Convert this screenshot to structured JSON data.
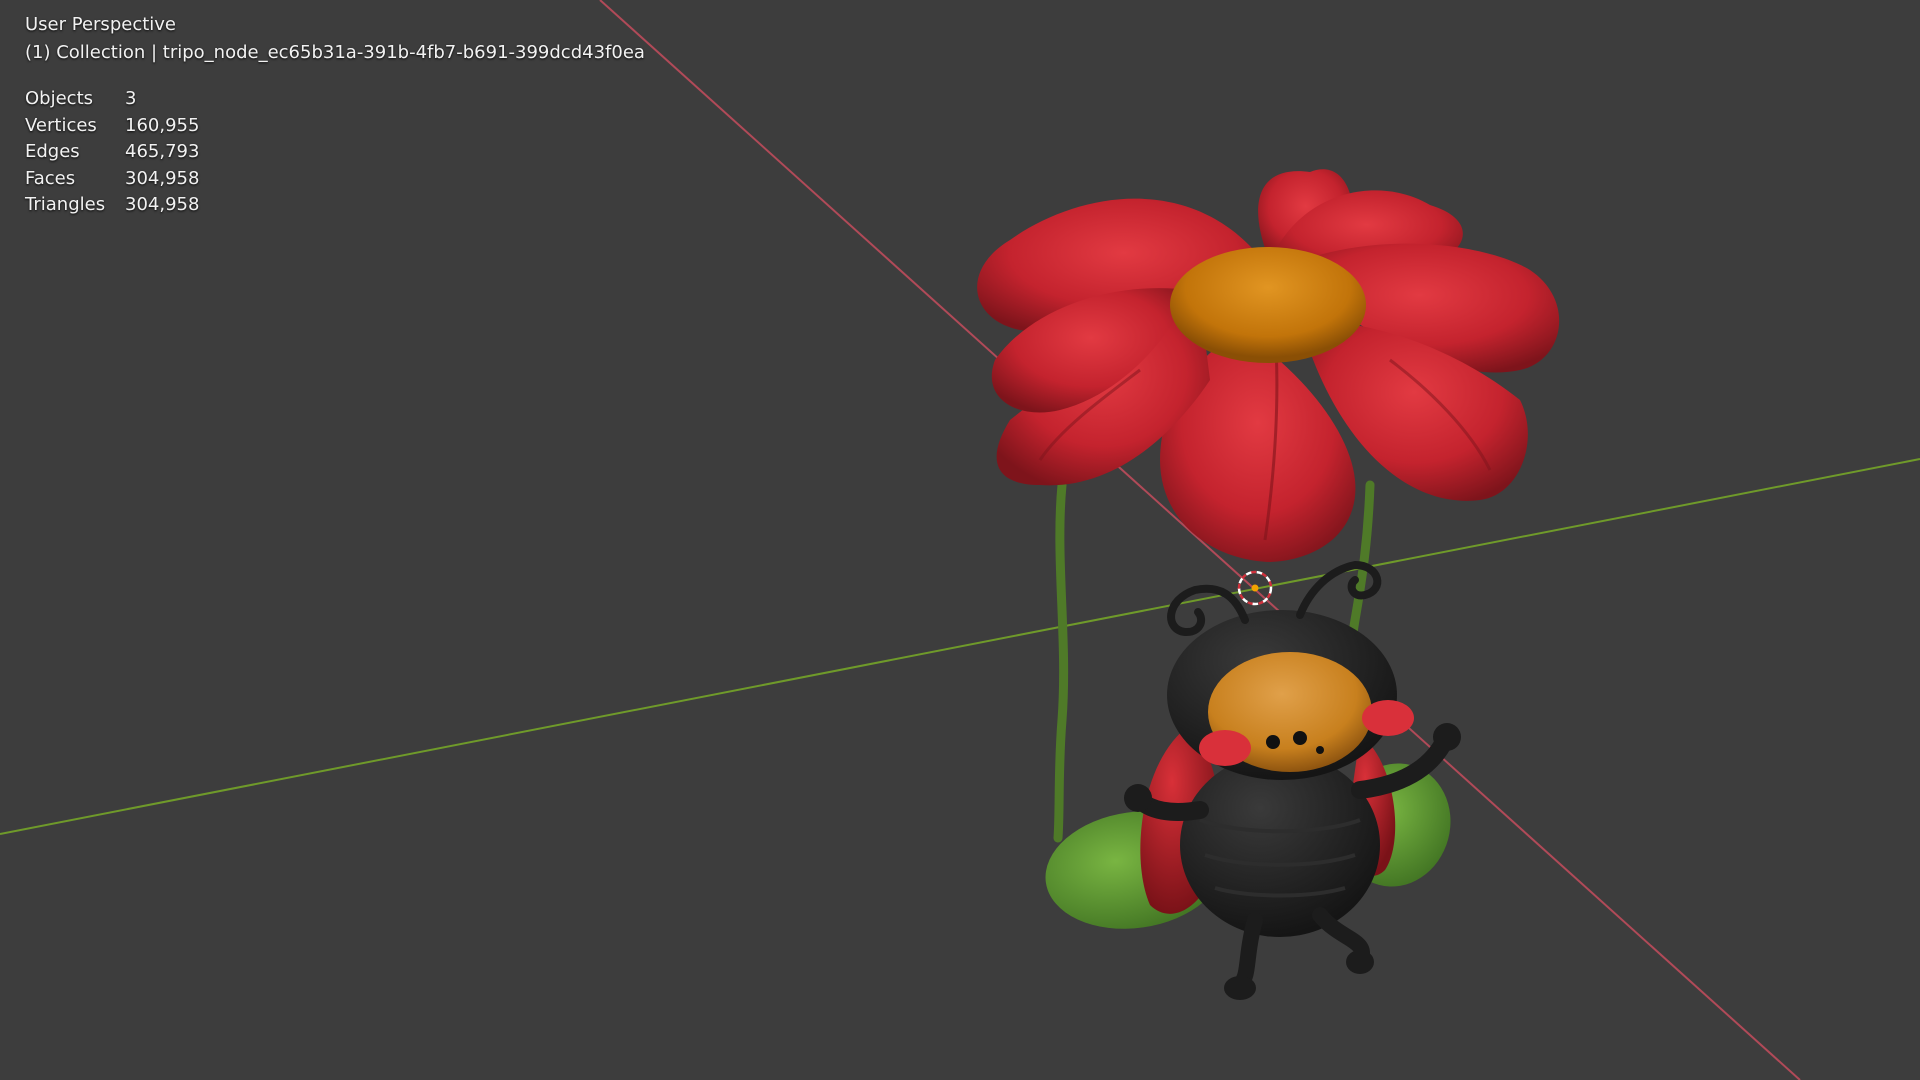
{
  "viewport": {
    "perspective": "User Perspective",
    "collection_line": "(1) Collection | tripo_node_ec65b31a-391b-4fb7-b691-399dcd43f0ea",
    "stats": [
      {
        "label": "Objects",
        "value": "3"
      },
      {
        "label": "Vertices",
        "value": "160,955"
      },
      {
        "label": "Edges",
        "value": "465,793"
      },
      {
        "label": "Faces",
        "value": "304,958"
      },
      {
        "label": "Triangles",
        "value": "304,958"
      }
    ]
  },
  "colors": {
    "background": "#3d3d3d",
    "x_axis": "#b04a58",
    "y_axis": "#6f9a2a",
    "petal": "#c4232e",
    "petal_shadow": "#8e1a22",
    "flower_center": "#c2740a",
    "stem": "#4f7a28",
    "leaf": "#5d9a2f",
    "bug_body": "#1f1f1f",
    "bug_face": "#c8801e",
    "bug_wing": "#b41e26",
    "cheek": "#d9303a"
  },
  "icons": {
    "origin": "3d-cursor-icon"
  }
}
